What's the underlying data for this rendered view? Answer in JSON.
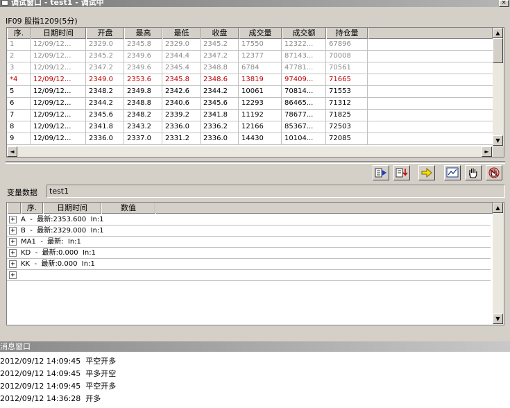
{
  "window": {
    "title": "调试窗口 - test1 - 调试中",
    "close_glyph": "×"
  },
  "caption": "IF09 股指1209(5分)",
  "price_table": {
    "columns": [
      "序.",
      "日期时间",
      "开盘",
      "最高",
      "最低",
      "收盘",
      "成交量",
      "成交额",
      "持仓量"
    ],
    "rows": [
      {
        "style": "gray",
        "cells": [
          "1",
          "12/09/12...",
          "2329.0",
          "2345.8",
          "2329.0",
          "2345.2",
          "17550",
          "12322...",
          "67896"
        ]
      },
      {
        "style": "gray",
        "cells": [
          "2",
          "12/09/12...",
          "2345.2",
          "2349.6",
          "2344.4",
          "2347.2",
          "12377",
          "87143...",
          "70008"
        ]
      },
      {
        "style": "gray",
        "cells": [
          "3",
          "12/09/12...",
          "2347.2",
          "2349.6",
          "2345.4",
          "2348.8",
          "6784",
          "47781...",
          "70561"
        ]
      },
      {
        "style": "red",
        "cells": [
          "*4",
          "12/09/12...",
          "2349.0",
          "2353.6",
          "2345.8",
          "2348.6",
          "13819",
          "97409...",
          "71665"
        ]
      },
      {
        "style": "normal",
        "cells": [
          "5",
          "12/09/12...",
          "2348.2",
          "2349.8",
          "2342.6",
          "2344.2",
          "10061",
          "70814...",
          "71553"
        ]
      },
      {
        "style": "normal",
        "cells": [
          "6",
          "12/09/12...",
          "2344.2",
          "2348.8",
          "2340.6",
          "2345.6",
          "12293",
          "86465...",
          "71312"
        ]
      },
      {
        "style": "normal",
        "cells": [
          "7",
          "12/09/12...",
          "2345.6",
          "2348.2",
          "2339.2",
          "2341.8",
          "11192",
          "78677...",
          "71825"
        ]
      },
      {
        "style": "normal",
        "cells": [
          "8",
          "12/09/12...",
          "2341.8",
          "2343.2",
          "2336.0",
          "2336.2",
          "12166",
          "85367...",
          "72503"
        ]
      },
      {
        "style": "normal",
        "cells": [
          "9",
          "12/09/12...",
          "2336.0",
          "2337.0",
          "2331.2",
          "2336.0",
          "14430",
          "10104...",
          "72085"
        ]
      }
    ]
  },
  "toolbar": {
    "buttons": [
      {
        "name": "step-forward-button",
        "icon": "step-forward-icon"
      },
      {
        "name": "run-to-cursor-button",
        "icon": "run-to-cursor-icon"
      },
      {
        "name": "continue-button",
        "icon": "arrow-right-icon"
      },
      {
        "name": "chart-button",
        "icon": "chart-icon"
      },
      {
        "name": "pause-button",
        "icon": "hand-icon"
      },
      {
        "name": "stop-button",
        "icon": "hand-stop-icon"
      }
    ]
  },
  "variables": {
    "label": "变量数据",
    "field_value": "test1",
    "columns": [
      "序.",
      "日期时间",
      "数值"
    ],
    "rows": [
      "A  -  最新:2353.600  In:1",
      "B  -  最新:2329.000  In:1",
      "MA1  -  最新:  In:1",
      "KD  -  最新:0.000  In:1",
      "KK  -  最新:0.000  In:1",
      ""
    ],
    "expand_glyph": "+"
  },
  "messages": {
    "title": "消息窗口",
    "lines": [
      "2012/09/12 14:09:45  平空开多",
      "2012/09/12 14:09:45  平多开空",
      "2012/09/12 14:09:45  平空开多",
      "2012/09/12 14:36:28  开多"
    ]
  },
  "scroll_glyphs": {
    "up": "▲",
    "down": "▼",
    "left": "◄",
    "right": "►"
  }
}
